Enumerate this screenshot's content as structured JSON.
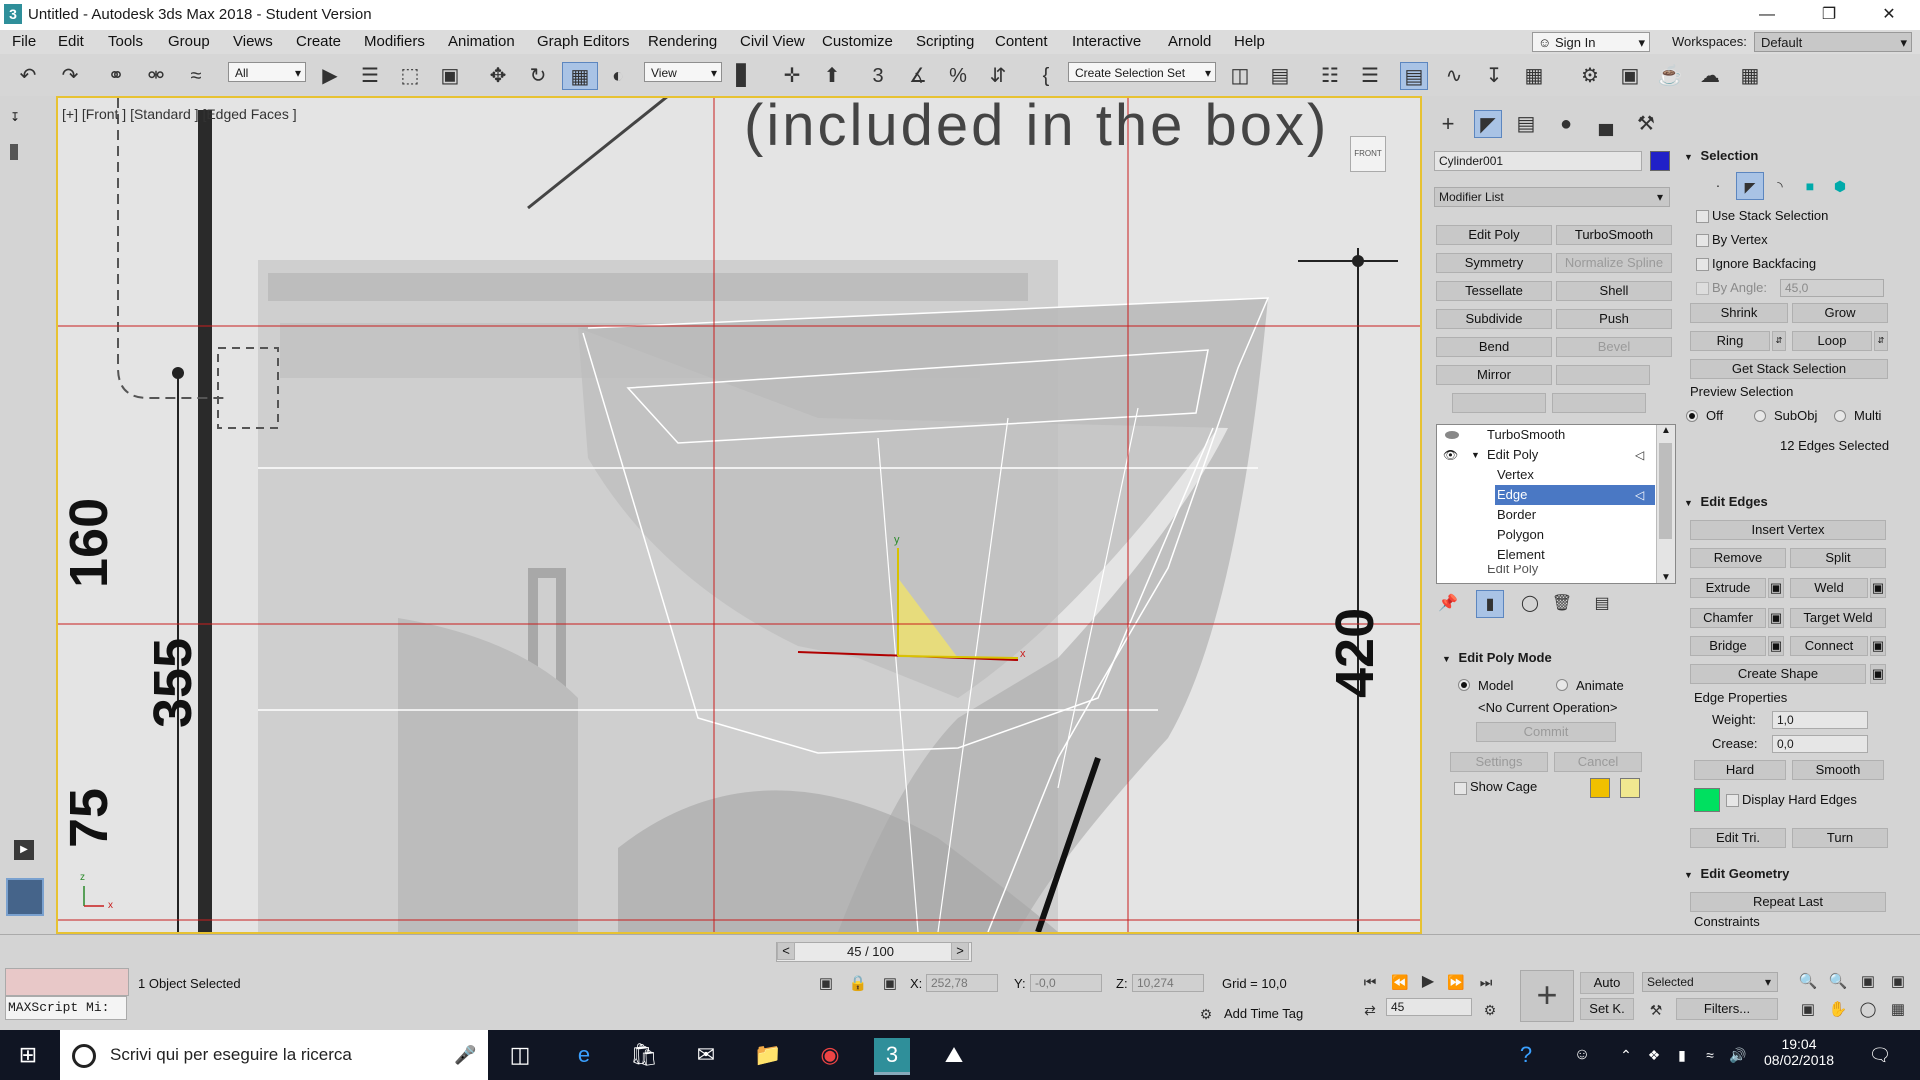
{
  "window": {
    "title": "Untitled - Autodesk 3ds Max 2018 - Student Version",
    "app_icon": "3"
  },
  "menu": [
    "File",
    "Edit",
    "Tools",
    "Group",
    "Views",
    "Create",
    "Modifiers",
    "Animation",
    "Graph Editors",
    "Rendering",
    "Civil View",
    "Customize",
    "Scripting",
    "Content",
    "Interactive",
    "Arnold",
    "Help"
  ],
  "account": {
    "sign_in": "Sign In",
    "workspaces_label": "Workspaces:",
    "workspace": "Default"
  },
  "toolbar": {
    "filter": "All",
    "ref_coord": "View",
    "selection_set": "Create Selection Set",
    "snap_angle": "3",
    "percent": "%"
  },
  "viewport": {
    "label": "[+] [Front ] [Standard ] [Edged Faces ]",
    "viewcube": "FRONT",
    "drawing_text": "(included in the box)",
    "dim_355": "355",
    "dim_420": "420",
    "dim_160": "160",
    "dim_75": "75",
    "gizmo_y": "y",
    "gizmo_x": "x",
    "axis_z": "z",
    "axis_x": "x"
  },
  "command_panel": {
    "object_name": "Cylinder001",
    "object_color": "#2020c8",
    "modifier_list": "Modifier List",
    "mod_buttons": [
      {
        "label": "Edit Poly",
        "enabled": true
      },
      {
        "label": "TurboSmooth",
        "enabled": true
      },
      {
        "label": "Symmetry",
        "enabled": true
      },
      {
        "label": "Normalize Spline",
        "enabled": false
      },
      {
        "label": "Tessellate",
        "enabled": true
      },
      {
        "label": "Shell",
        "enabled": true
      },
      {
        "label": "Subdivide",
        "enabled": true
      },
      {
        "label": "Push",
        "enabled": true
      },
      {
        "label": "Bend",
        "enabled": true
      },
      {
        "label": "Bevel",
        "enabled": false
      },
      {
        "label": "Mirror",
        "enabled": true
      },
      {
        "label": "",
        "enabled": true
      },
      {
        "label": "",
        "enabled": true
      },
      {
        "label": "",
        "enabled": true
      }
    ],
    "stack": {
      "top": "TurboSmooth",
      "edit_poly": "Edit Poly",
      "subobjects": [
        "Vertex",
        "Edge",
        "Border",
        "Polygon",
        "Element"
      ],
      "selected": "Edge",
      "cut": "Edit Poly"
    },
    "edit_poly_mode": {
      "title": "Edit Poly Mode",
      "model": "Model",
      "animate": "Animate",
      "current_op": "<No Current Operation>",
      "commit": "Commit",
      "settings": "Settings",
      "cancel": "Cancel",
      "show_cage": "Show Cage",
      "cage_color1": "#f0c000",
      "cage_color2": "#f0e890"
    },
    "selection": {
      "title": "Selection",
      "use_stack": "Use Stack Selection",
      "by_vertex": "By Vertex",
      "ignore_backfacing": "Ignore Backfacing",
      "by_angle": "By Angle:",
      "by_angle_value": "45,0",
      "shrink": "Shrink",
      "grow": "Grow",
      "ring": "Ring",
      "loop": "Loop",
      "get_stack": "Get Stack Selection",
      "preview": "Preview Selection",
      "off": "Off",
      "subobj": "SubObj",
      "multi": "Multi",
      "status": "12 Edges Selected"
    },
    "edit_edges": {
      "title": "Edit Edges",
      "insert_vertex": "Insert Vertex",
      "remove": "Remove",
      "split": "Split",
      "extrude": "Extrude",
      "weld": "Weld",
      "chamfer": "Chamfer",
      "target_weld": "Target Weld",
      "bridge": "Bridge",
      "connect": "Connect",
      "create_shape": "Create Shape",
      "edge_props": "Edge Properties",
      "weight_lbl": "Weight:",
      "weight": "1,0",
      "crease_lbl": "Crease:",
      "crease": "0,0",
      "hard": "Hard",
      "smooth": "Smooth",
      "display_hard": "Display Hard Edges",
      "hard_color": "#00e060",
      "edit_tri": "Edit Tri.",
      "turn": "Turn"
    },
    "edit_geometry": {
      "title": "Edit Geometry",
      "repeat_last": "Repeat Last",
      "constraints": "Constraints"
    }
  },
  "timeline": {
    "frame": "45 / 100",
    "prev": "<",
    "next": ">"
  },
  "status": {
    "maxscript": "MAXScript Mi:",
    "objects": "1 Object Selected",
    "x_lbl": "X:",
    "x": "252,78",
    "y_lbl": "Y:",
    "y": "-0,0",
    "z_lbl": "Z:",
    "z": "10,274",
    "grid": "Grid = 10,0",
    "add_time_tag": "Add Time Tag",
    "auto": "Auto",
    "selected_dd": "Selected",
    "set_key": "Set K.",
    "filters": "Filters...",
    "frame_field": "45"
  },
  "taskbar": {
    "search": "Scrivi qui per eseguire la ricerca",
    "time": "19:04",
    "date": "08/02/2018"
  }
}
